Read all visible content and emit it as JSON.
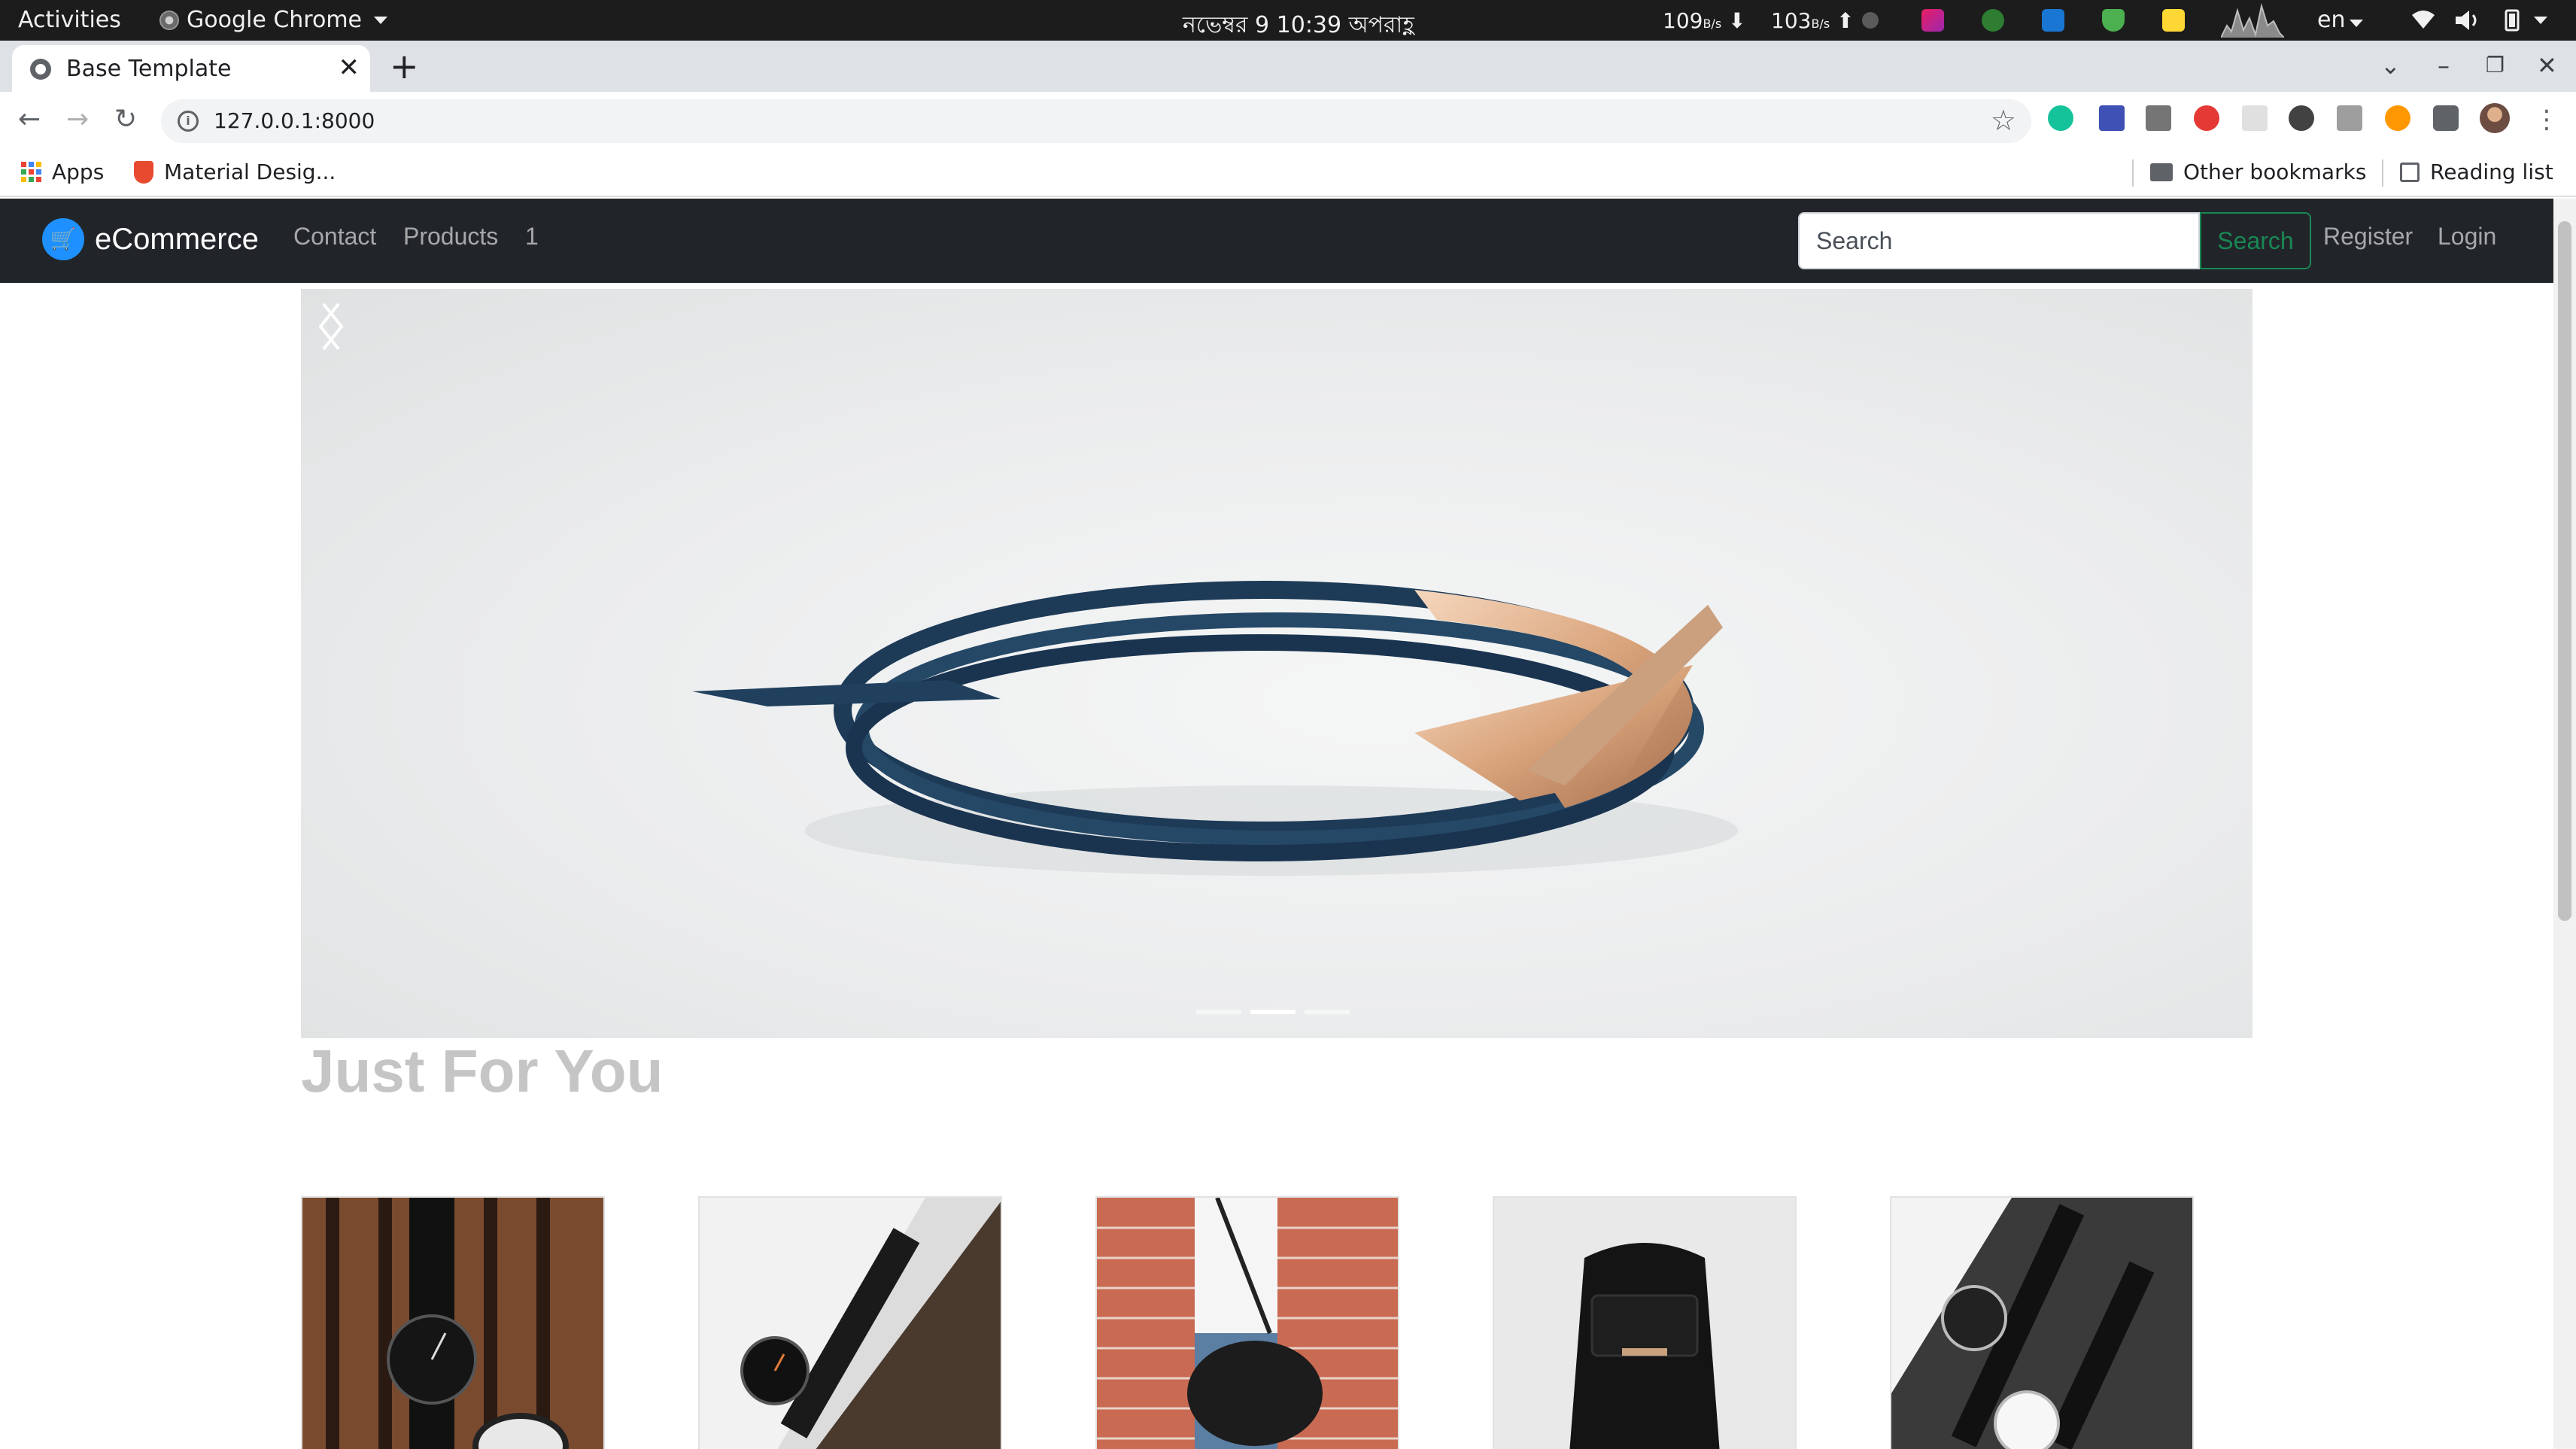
{
  "system_bar": {
    "activities": "Activities",
    "app_name": "Google Chrome",
    "clock": "নভেম্বর 9  10:39 অপরাহ্ণ",
    "net_down": "109",
    "net_down_unit": "B/s",
    "net_up": "103",
    "net_up_unit": "B/s",
    "language": "en"
  },
  "browser": {
    "tab_title": "Base Template",
    "new_tab": "+",
    "url": "127.0.0.1:8000",
    "bookmarks": {
      "apps": "Apps",
      "material": "Material Desig...",
      "other": "Other bookmarks",
      "reading_list": "Reading list"
    }
  },
  "site": {
    "brand": "eCommerce",
    "nav": {
      "contact": "Contact",
      "products": "Products",
      "cart_count": "1"
    },
    "search": {
      "placeholder": "Search",
      "button": "Search"
    },
    "auth": {
      "register": "Register",
      "login": "Login"
    },
    "carousel": {
      "slide_count": 3,
      "active_index": 1
    },
    "section_title": "Just For You",
    "products": [
      {
        "image": "watch-on-wood-photo"
      },
      {
        "image": "watch-on-marble-photo"
      },
      {
        "image": "man-with-bag-photo"
      },
      {
        "image": "black-backpack-photo"
      },
      {
        "image": "two-watches-photo"
      }
    ]
  },
  "colors": {
    "navbar_bg": "#212529",
    "brand_icon": "#1e90ff",
    "search_button": "#198754",
    "section_title": "#c5c5c5"
  }
}
